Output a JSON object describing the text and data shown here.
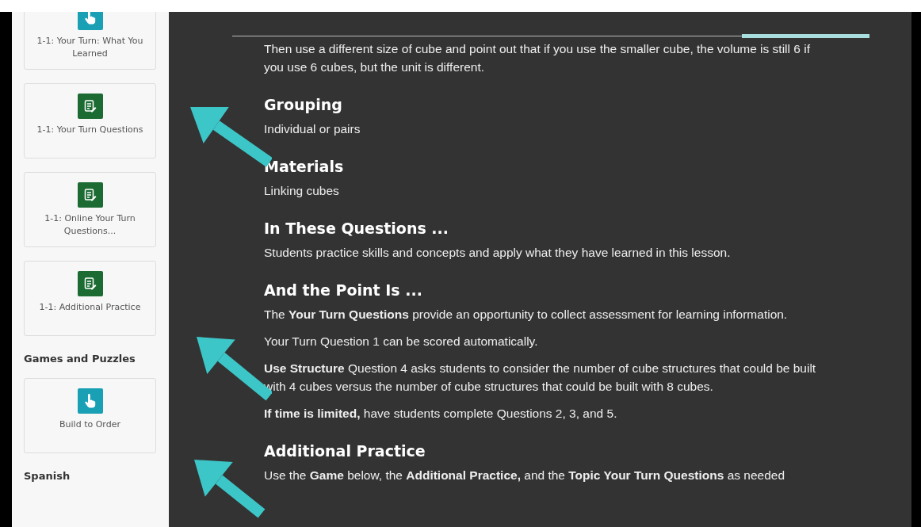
{
  "sidebar": {
    "items": [
      {
        "kind": "activity",
        "label": "1-1: Your Turn: What You Learned"
      },
      {
        "kind": "document",
        "label": "1-1: Your Turn Questions"
      },
      {
        "kind": "document",
        "label": "1-1: Online Your Turn Questions..."
      },
      {
        "kind": "document",
        "label": "1-1: Additional Practice"
      },
      {
        "kind": "heading",
        "label": "Games and Puzzles"
      },
      {
        "kind": "activity",
        "label": "Build to Order"
      },
      {
        "kind": "heading",
        "label": "Spanish"
      }
    ]
  },
  "tabs": [
    {
      "selected": false
    },
    {
      "selected": false
    },
    {
      "selected": false
    },
    {
      "selected": false
    },
    {
      "selected": true
    }
  ],
  "content": [
    {
      "kind": "paragraph",
      "text": "Then use a different size of cube and point out that if you use the smaller cube, the volume is still 6 if you use 6 cubes, but the unit is different."
    },
    {
      "kind": "heading",
      "text": "Grouping"
    },
    {
      "kind": "paragraph",
      "text": "Individual or pairs"
    },
    {
      "kind": "heading",
      "text": "Materials"
    },
    {
      "kind": "paragraph",
      "text": "Linking cubes"
    },
    {
      "kind": "heading",
      "text": "In These Questions ..."
    },
    {
      "kind": "paragraph",
      "text": "Students practice skills and concepts and apply what they have learned in this lesson."
    },
    {
      "kind": "heading",
      "text": "And the Point Is ..."
    },
    {
      "kind": "paragraph",
      "text": "The **Your Turn Questions** provide an opportunity to collect assessment for learning information."
    },
    {
      "kind": "paragraph",
      "text": "Your Turn Question 1 can be scored automatically."
    },
    {
      "kind": "paragraph",
      "text": "**Use Structure** Question 4 asks students to consider the number of cube structures that could be built with 4 cubes versus the number of cube structures that could be built with 8 cubes."
    },
    {
      "kind": "paragraph",
      "text": "**If time is limited,** have students complete Questions 2, 3, and 5."
    },
    {
      "kind": "heading",
      "text": "Additional Practice"
    },
    {
      "kind": "paragraph",
      "text": "Use the **Game** below, the **Additional Practice,** and the **Topic Your Turn Questions** as needed"
    }
  ]
}
